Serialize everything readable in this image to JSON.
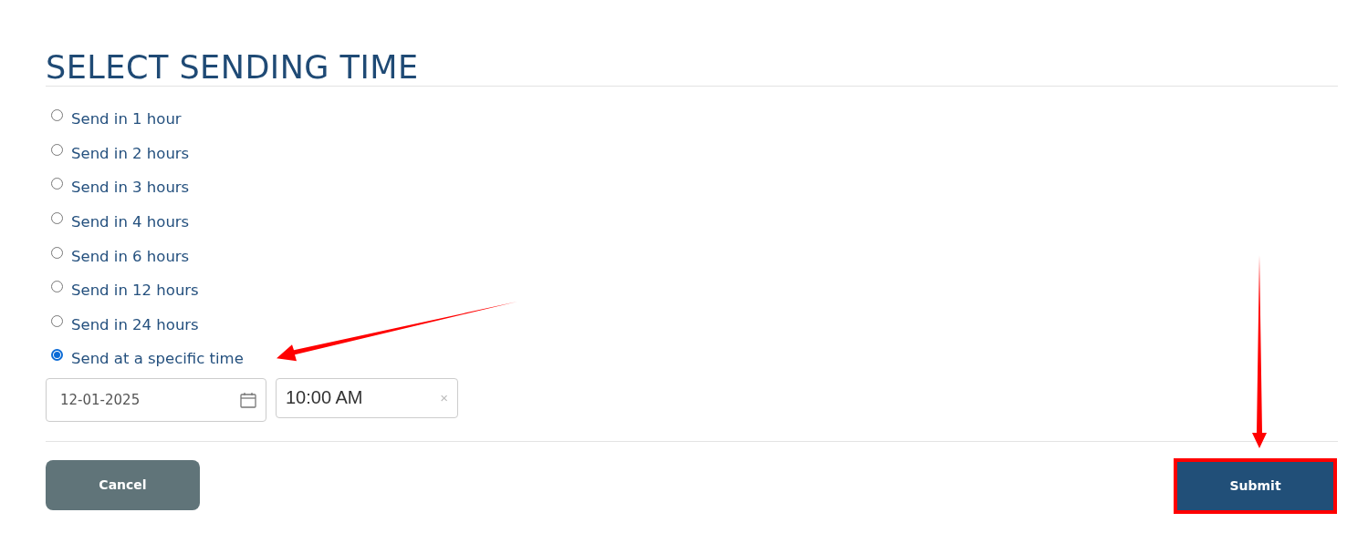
{
  "title": "SELECT SENDING TIME",
  "options": [
    {
      "label": "Send in 1 hour",
      "selected": false,
      "annotated": false
    },
    {
      "label": "Send in 2 hours",
      "selected": false,
      "annotated": false
    },
    {
      "label": "Send in 3 hours",
      "selected": false,
      "annotated": false
    },
    {
      "label": "Send in 4 hours",
      "selected": false,
      "annotated": false
    },
    {
      "label": "Send in 6 hours",
      "selected": false,
      "annotated": false
    },
    {
      "label": "Send in 12 hours",
      "selected": false,
      "annotated": false
    },
    {
      "label": "Send in 24 hours",
      "selected": false,
      "annotated": false
    },
    {
      "label": "Send at a specific time",
      "selected": true,
      "annotated": true
    }
  ],
  "date_field": {
    "value": "12-01-2025"
  },
  "time_field": {
    "value": "10:00 AM",
    "clear": "×"
  },
  "buttons": [
    {
      "kind": "cancel",
      "label": "Cancel",
      "highlighted": false
    },
    {
      "kind": "submit",
      "label": "Submit",
      "highlighted": true
    }
  ]
}
